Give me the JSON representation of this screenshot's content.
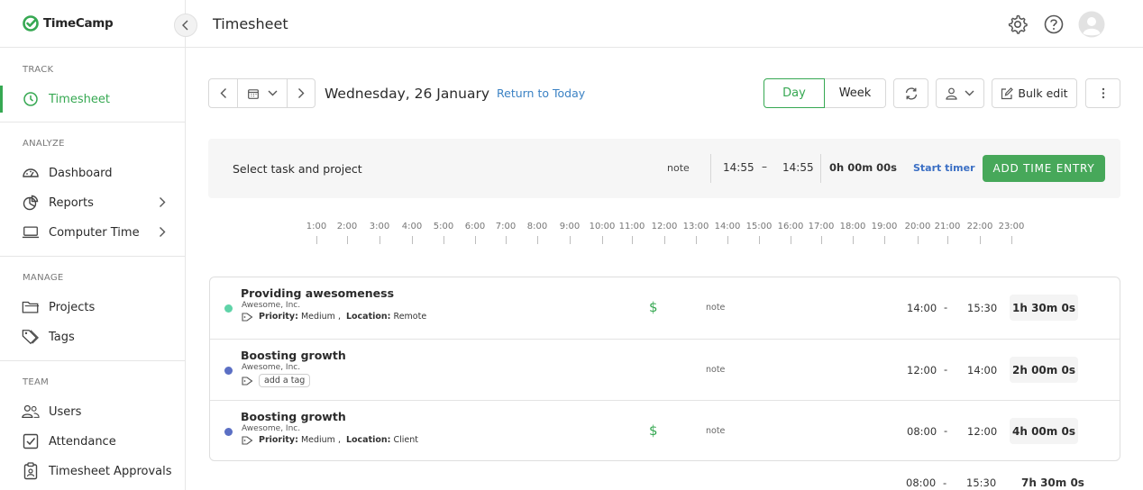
{
  "brand": {
    "name": "TimeCamp",
    "accent": "#36a852"
  },
  "sidebar": {
    "sections": [
      {
        "title": "TRACK",
        "items": [
          {
            "label": "Timesheet",
            "icon": "clock-icon",
            "active": true
          }
        ]
      },
      {
        "title": "ANALYZE",
        "items": [
          {
            "label": "Dashboard",
            "icon": "gauge-icon"
          },
          {
            "label": "Reports",
            "icon": "pie-chart-icon",
            "expandable": true
          },
          {
            "label": "Computer Time",
            "icon": "laptop-icon",
            "expandable": true
          }
        ]
      },
      {
        "title": "MANAGE",
        "items": [
          {
            "label": "Projects",
            "icon": "folder-icon"
          },
          {
            "label": "Tags",
            "icon": "tags-icon"
          }
        ]
      },
      {
        "title": "TEAM",
        "items": [
          {
            "label": "Users",
            "icon": "users-icon"
          },
          {
            "label": "Attendance",
            "icon": "checkbox-icon"
          },
          {
            "label": "Timesheet Approvals",
            "icon": "clipboard-icon"
          }
        ]
      }
    ]
  },
  "header": {
    "title": "Timesheet"
  },
  "toolbar": {
    "date": "Wednesday, 26 January",
    "return_today": "Return to Today",
    "view_day": "Day",
    "view_week": "Week",
    "bulk_edit": "Bulk edit"
  },
  "entry_bar": {
    "task_placeholder": "Select task and project",
    "note": "note",
    "start": "14:55",
    "dash": "–",
    "end": "14:55",
    "duration": "0h 00m 00s",
    "start_timer": "Start timer",
    "add_entry": "ADD TIME ENTRY"
  },
  "timeline": {
    "hours": [
      "1:00",
      "2:00",
      "3:00",
      "4:00",
      "5:00",
      "6:00",
      "7:00",
      "8:00",
      "9:00",
      "10:00",
      "11:00",
      "12:00",
      "13:00",
      "14:00",
      "15:00",
      "16:00",
      "17:00",
      "18:00",
      "19:00",
      "20:00",
      "21:00",
      "22:00",
      "23:00"
    ]
  },
  "entries": [
    {
      "task": "Providing awesomeness",
      "client": "Awesome, Inc.",
      "tags": [
        {
          "key": "Priority:",
          "value": "Medium ,"
        },
        {
          "key": "Location:",
          "value": "Remote"
        }
      ],
      "billable": true,
      "dot_color": "#5fd3a8",
      "note": "note",
      "start": "14:00",
      "end": "15:30",
      "duration": "1h 30m 0s"
    },
    {
      "task": "Boosting growth",
      "client": "Awesome, Inc.",
      "tags": [],
      "add_tag": "add a tag",
      "billable": false,
      "dot_color": "#5b6fc4",
      "note": "note",
      "start": "12:00",
      "end": "14:00",
      "duration": "2h 00m 0s"
    },
    {
      "task": "Boosting growth",
      "client": "Awesome, Inc.",
      "tags": [
        {
          "key": "Priority:",
          "value": "Medium ,"
        },
        {
          "key": "Location:",
          "value": "Client"
        }
      ],
      "billable": true,
      "dot_color": "#5b6fc4",
      "note": "note",
      "start": "08:00",
      "end": "12:00",
      "duration": "4h 00m 0s"
    }
  ],
  "dash": "-",
  "totals": {
    "start": "08:00",
    "end": "15:30",
    "duration": "7h 30m 0s"
  },
  "billable_symbol": "$"
}
